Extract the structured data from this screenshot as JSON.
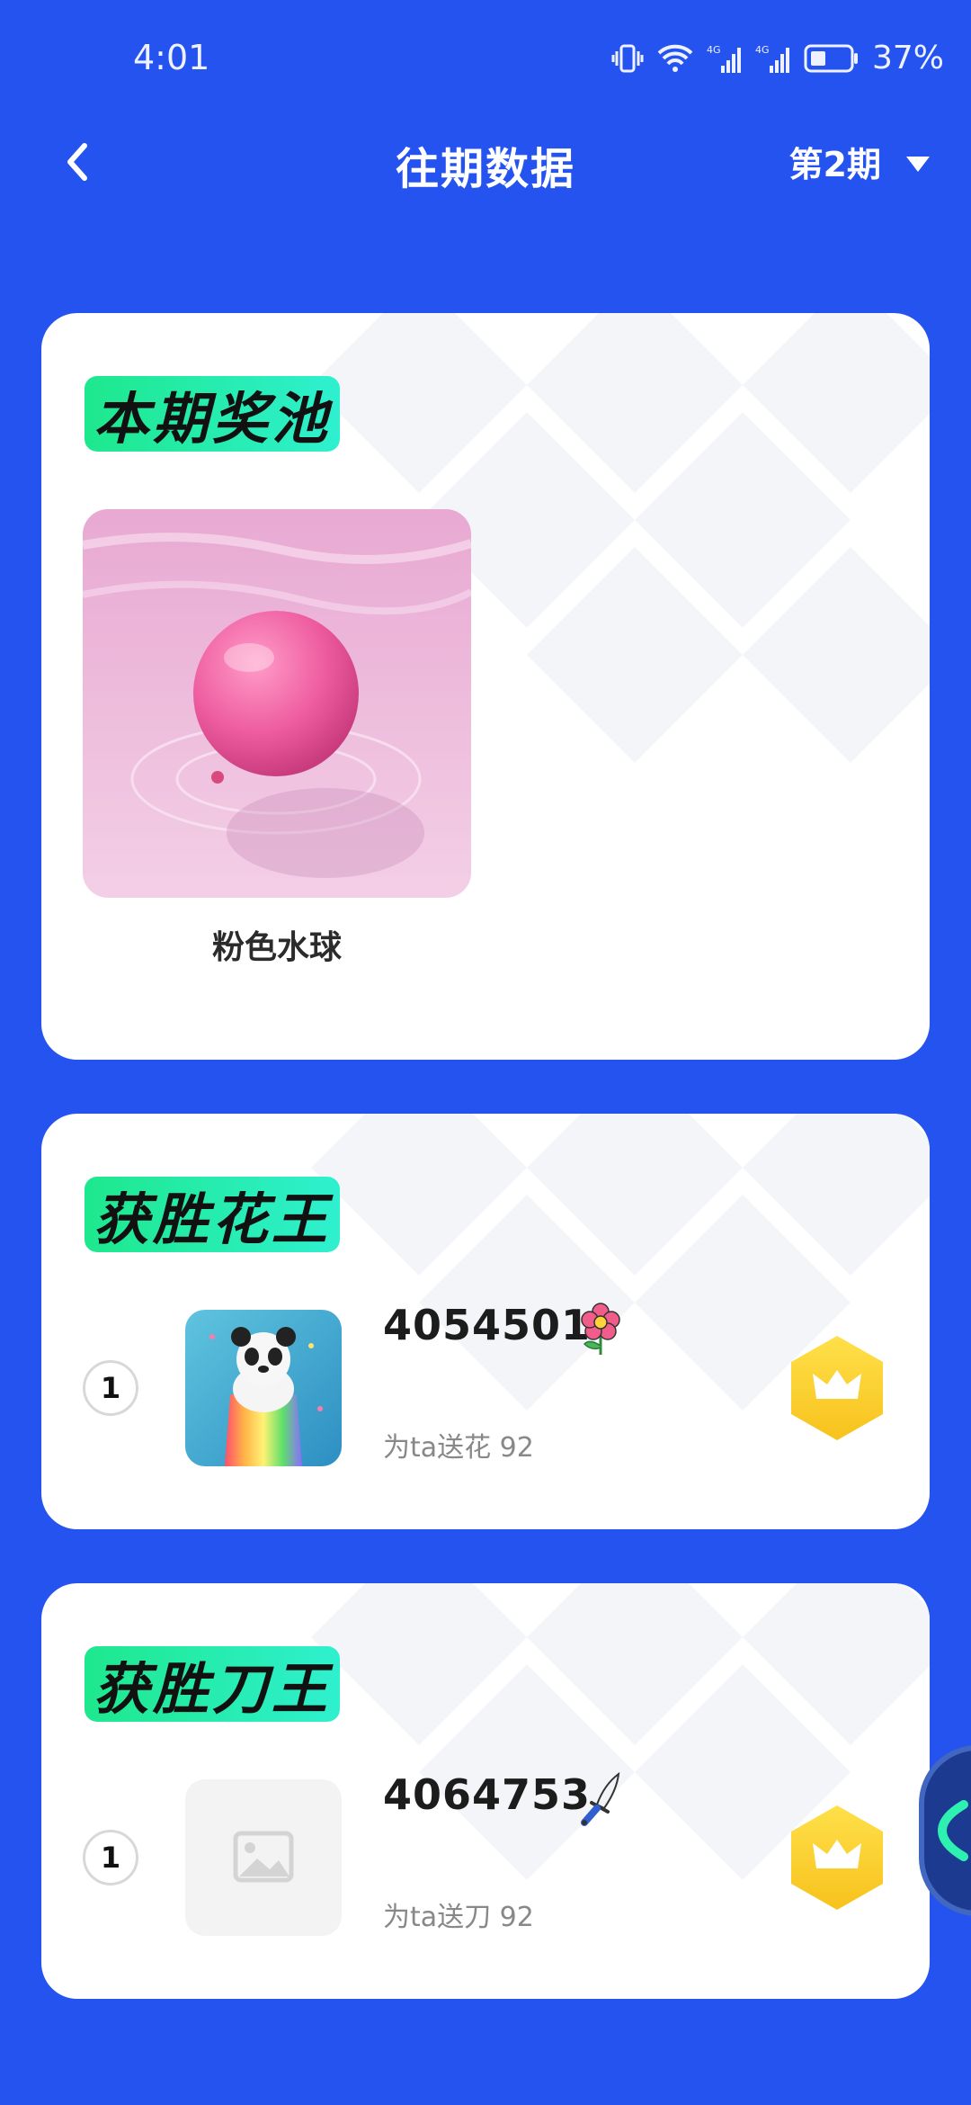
{
  "status": {
    "time": "4:01",
    "battery_pct": "37%",
    "net1": "4G",
    "net2": "4G"
  },
  "header": {
    "title": "往期数据",
    "period": "第2期"
  },
  "prize_pool": {
    "title": "本期奖池",
    "items": [
      {
        "name": "粉色水球"
      }
    ]
  },
  "flower_king": {
    "title": "获胜花王",
    "entries": [
      {
        "rank": "1",
        "id": "4054501",
        "text": "为ta送花 92",
        "item_icon": "flower-icon"
      }
    ]
  },
  "knife_king": {
    "title": "获胜刀王",
    "entries": [
      {
        "rank": "1",
        "id": "4064753",
        "text": "为ta送刀 92",
        "item_icon": "knife-icon"
      }
    ]
  },
  "colors": {
    "background": "#2553f0",
    "title_gradient_start": "#1ee88d",
    "title_gradient_end": "#2ff0cf",
    "crown_badge": "#fbd431"
  }
}
